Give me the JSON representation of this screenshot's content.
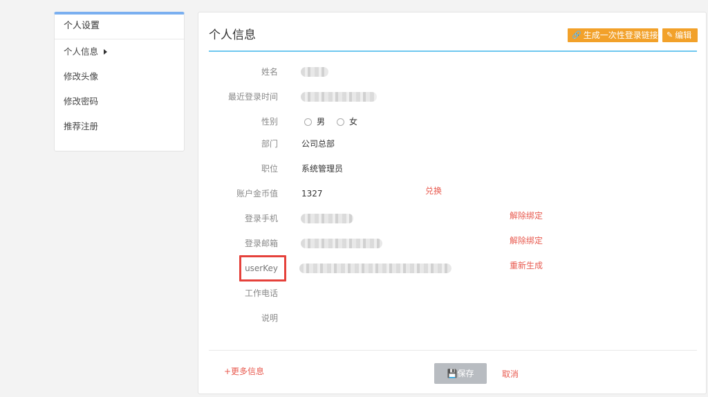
{
  "sidebar": {
    "title": "个人设置",
    "items": [
      {
        "label": "个人信息",
        "active": true
      },
      {
        "label": "修改头像"
      },
      {
        "label": "修改密码"
      },
      {
        "label": "推荐注册"
      }
    ]
  },
  "header": {
    "title": "个人信息",
    "generate_link_label": "生成一次性登录链接",
    "edit_label": "编辑"
  },
  "form": {
    "name_label": "姓名",
    "last_login_label": "最近登录时间",
    "gender_label": "性别",
    "gender_male": "男",
    "gender_female": "女",
    "dept_label": "部门",
    "dept_value": "公司总部",
    "position_label": "职位",
    "position_value": "系统管理员",
    "coins_label": "账户金币值",
    "coins_value": "1327",
    "coins_action": "兑换",
    "phone_label": "登录手机",
    "phone_action": "解除绑定",
    "email_label": "登录邮箱",
    "email_action": "解除绑定",
    "userkey_label": "userKey",
    "userkey_action": "重新生成",
    "work_phone_label": "工作电话",
    "description_label": "说明"
  },
  "footer": {
    "more_info": "+更多信息",
    "save_label": "保存",
    "cancel_label": "取消"
  },
  "colors": {
    "accent_orange": "#f2a12a",
    "link_red": "#e85a4f",
    "header_line": "#6ec7ef",
    "highlight_box": "#e5413b"
  }
}
